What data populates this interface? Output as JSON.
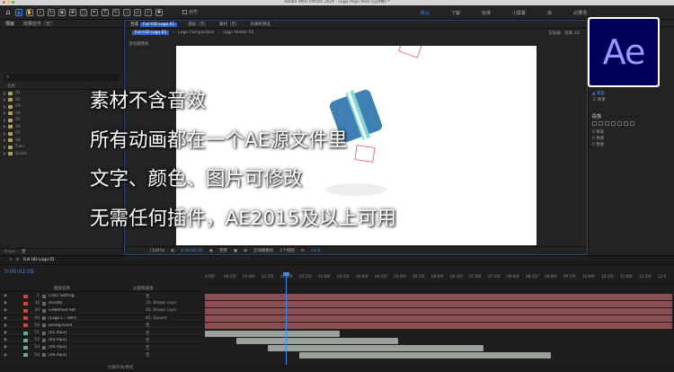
{
  "window": {
    "title": "Adobe After Effects 2020 - Logo Pogo Pack (已转换) *"
  },
  "toolbar": {
    "align_label": "对齐"
  },
  "workspaces": [
    {
      "label": "默认",
      "active": true
    },
    {
      "label": "了解",
      "active": false
    },
    {
      "label": "标准",
      "active": false
    },
    {
      "label": "小屏幕",
      "active": false
    },
    {
      "label": "库",
      "active": false
    },
    {
      "label": "必要项",
      "active": false
    }
  ],
  "project": {
    "tabs": [
      "项目",
      "效果控件（无）"
    ],
    "search_icon_glyph": "⌕",
    "column_header": "名称",
    "folders": [
      "01",
      "02",
      "03",
      "04",
      "05",
      "06",
      "07",
      "08",
      "Files",
      "Solids"
    ],
    "footer": [
      "8 bpc"
    ]
  },
  "composition": {
    "tabs": [
      {
        "label": "合成",
        "highlight": "Full HD Logo 01"
      },
      {
        "label": "图层（无）",
        "highlight": ""
      },
      {
        "label": "素材（无）",
        "highlight": ""
      },
      {
        "label": "效果和预设",
        "highlight": ""
      }
    ],
    "subtabs": [
      "Full HD Logo 01",
      "Logo Composition",
      "Logo Holder 01"
    ],
    "renderer": "渲染器：经典 3D",
    "camera_label": "活动摄像机",
    "controls": [
      "(100%)",
      "0;00;02;05",
      "完整",
      "活动摄像机",
      "1个视图",
      "+0.0"
    ]
  },
  "overlay_lines": [
    "素材不含音效",
    "所有动画都在一个AE源文件里",
    "文字、颜色、图片可修改",
    "无需任何插件，AE2015及以上可用"
  ],
  "ae_logo": {
    "text": "Ae"
  },
  "right_panel": {
    "header": "字符",
    "paragraph_title": "段落",
    "rows": [
      "0 像素",
      "0 像素",
      "0 像素"
    ]
  },
  "timeline": {
    "tab_label": "Full HD Logo 01",
    "timecode": "0;00;02;05",
    "col_source": "图层名称",
    "col_parent": "父级和链接",
    "footer": "切换开关/模式",
    "ticks": [
      "0:00f",
      "00:15f",
      "01:00f",
      "01:15f",
      "02:00f",
      "02:15f",
      "03:00f",
      "03:15f",
      "04:00f",
      "04:15f",
      "05:00f",
      "05:15f",
      "06:00f",
      "06:15f",
      "07:00f",
      "07:15f",
      "08:00f",
      "08:15f",
      "09:00f",
      "09:15f",
      "10:00f",
      "10:15f",
      "11:00f",
      "11:15f",
      "12:0"
    ],
    "layers": [
      {
        "num": "1",
        "name": "Color Setting",
        "parent": "无",
        "color": "#c8464b"
      },
      {
        "num": "33",
        "name": "envato",
        "parent": "31. Shape Laye",
        "color": "#c8464b"
      },
      {
        "num": "34",
        "name": "videohive.net",
        "parent": "40. Shape Laye",
        "color": "#c8464b"
      },
      {
        "num": "44",
        "name": "[Logo C...lder]",
        "parent": "45. Square",
        "color": "#c8464b"
      },
      {
        "num": "50",
        "name": "Background",
        "parent": "无",
        "color": "#c8464b"
      },
      {
        "num": "51",
        "name": "[01.mp3]",
        "parent": "无",
        "color": "#7aa0a0"
      },
      {
        "num": "52",
        "name": "[02.mp3]",
        "parent": "无",
        "color": "#7aa0a0"
      },
      {
        "num": "53",
        "name": "[04.mp3]",
        "parent": "无",
        "color": "#7aa0a0"
      },
      {
        "num": "54",
        "name": "[06.mp3]",
        "parent": "无",
        "color": "#7aa0a0"
      }
    ]
  },
  "colors": {
    "accent": "#3d8af7",
    "comp_highlight": "#2d62c9",
    "layer_bar_red": "#8c4e52",
    "layer_bar_audio": "#9aa09a",
    "ae_bg": "#00005b",
    "ae_text": "#9999ff",
    "logo_blue": "#3f7fb4",
    "logo_cyan": "#7fd9d6"
  }
}
